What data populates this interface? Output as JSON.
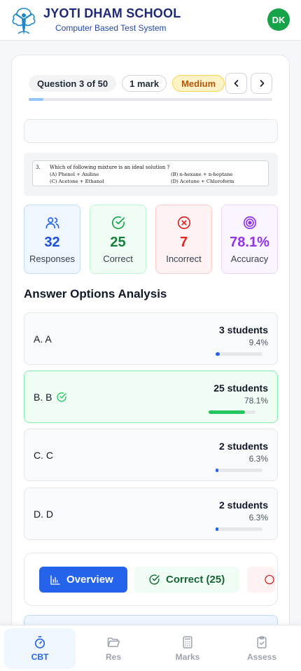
{
  "header": {
    "school_name": "JYOTI DHAM SCHOOL",
    "subtitle": "Computer Based Test System",
    "avatar_initials": "DK"
  },
  "question_bar": {
    "question_label": "Question 3 of 50",
    "marks": "1 mark",
    "difficulty": "Medium",
    "progress_fraction": 0.06
  },
  "question": {
    "number": "3.",
    "text": "Which of following mixture is an ideal solution ?",
    "options": [
      "(A)  Phenol + Aniline",
      "(B)  n-hexane + n-heptane",
      "(C)  Acetone + Ethanol",
      "(D)  Acetone + Chloroform"
    ]
  },
  "stats": {
    "responses": {
      "value": "32",
      "label": "Responses"
    },
    "correct": {
      "value": "25",
      "label": "Correct"
    },
    "incorrect": {
      "value": "7",
      "label": "Incorrect"
    },
    "accuracy": {
      "value": "78.1%",
      "label": "Accuracy"
    }
  },
  "analysis": {
    "title": "Answer Options Analysis",
    "options": [
      {
        "label": "A.  A",
        "students": "3 students",
        "percent": "9.4%",
        "fraction": 0.094,
        "correct": false
      },
      {
        "label": "B.  B",
        "students": "25 students",
        "percent": "78.1%",
        "fraction": 0.781,
        "correct": true
      },
      {
        "label": "C.  C",
        "students": "2 students",
        "percent": "6.3%",
        "fraction": 0.063,
        "correct": false
      },
      {
        "label": "D.  D",
        "students": "2 students",
        "percent": "6.3%",
        "fraction": 0.063,
        "correct": false
      }
    ]
  },
  "tabs": {
    "overview": "Overview",
    "correct": "Correct (25)"
  },
  "bottom_nav": {
    "cbt": "CBT",
    "res": "Res",
    "marks": "Marks",
    "assess": "Assess"
  },
  "colors": {
    "brand": "#1e2a78",
    "primary": "#2563eb",
    "success": "#16a34a",
    "danger": "#dc2626",
    "accuracy": "#9333ea",
    "warning": "#b45309"
  }
}
